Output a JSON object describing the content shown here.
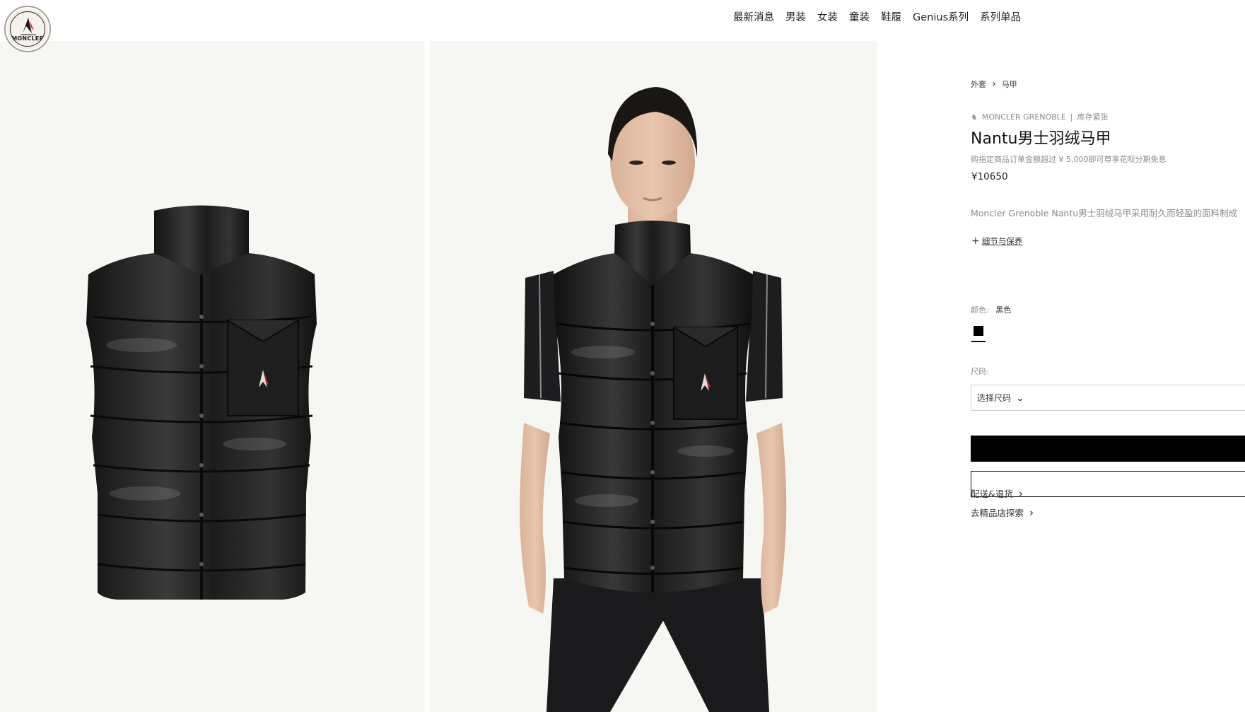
{
  "brand": {
    "logo_text": "MONCLER"
  },
  "nav": {
    "items": [
      "最新消息",
      "男装",
      "女装",
      "童装",
      "鞋履",
      "Genius系列",
      "系列单品"
    ]
  },
  "breadcrumb": {
    "items": [
      "外套",
      "马甲"
    ],
    "separator": "›"
  },
  "product": {
    "brand_line": "MONCLER GRENOBLE",
    "divider": "|",
    "stock_status": "库存紧张",
    "title": "Nantu男士羽绒马甲",
    "promo": "购指定商品订单金额超过 ¥ 5,000即可尊享花呗分期免息",
    "price": "¥10650",
    "description": "Moncler Grenoble Nantu男士羽绒马甲采用耐久而轻盈的面料制成",
    "details_label": "细节与保养",
    "details_icon": "+",
    "color_label": "颜色:",
    "color_value": "黑色",
    "color_swatch": "#000000",
    "size_label": "尺码:",
    "size_placeholder": "选择尺码",
    "size_chevron": "⌄"
  },
  "links": {
    "shipping": "配送&退货",
    "boutique": "去精品店探索",
    "arrow": "›"
  },
  "images": {
    "left_alt": "black-down-vest-product-shot",
    "right_alt": "model-wearing-black-down-vest"
  },
  "colors": {
    "background_gallery": "#f6f6f3",
    "vest": "#1c1c1c",
    "button_primary": "#000000"
  }
}
